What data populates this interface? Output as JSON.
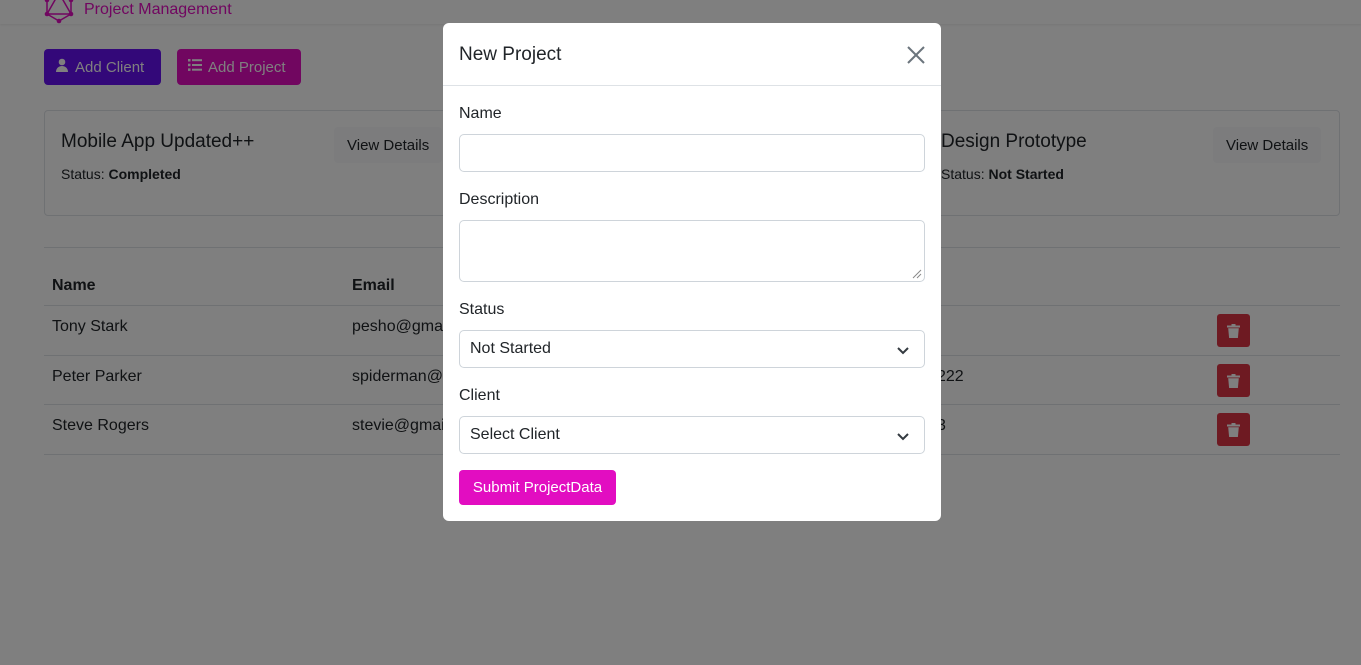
{
  "navbar": {
    "brand": "Project Management",
    "logo_icon": "graphql-logo-icon"
  },
  "actions": {
    "add_client": "Add Client",
    "add_project": "Add Project"
  },
  "projects": [
    {
      "name": "Mobile App Updated++",
      "status_label": "Status:",
      "status": "Completed",
      "view": "View Details"
    },
    {
      "name": "Design Prototype",
      "status_label": "Status:",
      "status": "Not Started",
      "view": "View Details"
    }
  ],
  "clients": {
    "headers": [
      "Name",
      "Email"
    ],
    "rows": [
      {
        "name": "Tony Stark",
        "email": "pesho@gma",
        "phone": ""
      },
      {
        "name": "Peter Parker",
        "email": "spiderman@",
        "phone": "222"
      },
      {
        "name": "Steve Rogers",
        "email": "stevie@gmai",
        "phone": "3"
      }
    ]
  },
  "modal": {
    "title": "New Project",
    "name_label": "Name",
    "name_value": "",
    "description_label": "Description",
    "description_value": "",
    "status_label": "Status",
    "status_value": "Not Started",
    "client_label": "Client",
    "client_value": "Select Client",
    "submit": "Submit ProjectData"
  },
  "colors": {
    "primary": "#6610f2",
    "secondary": "#e20dc1",
    "danger": "#dc3545"
  }
}
